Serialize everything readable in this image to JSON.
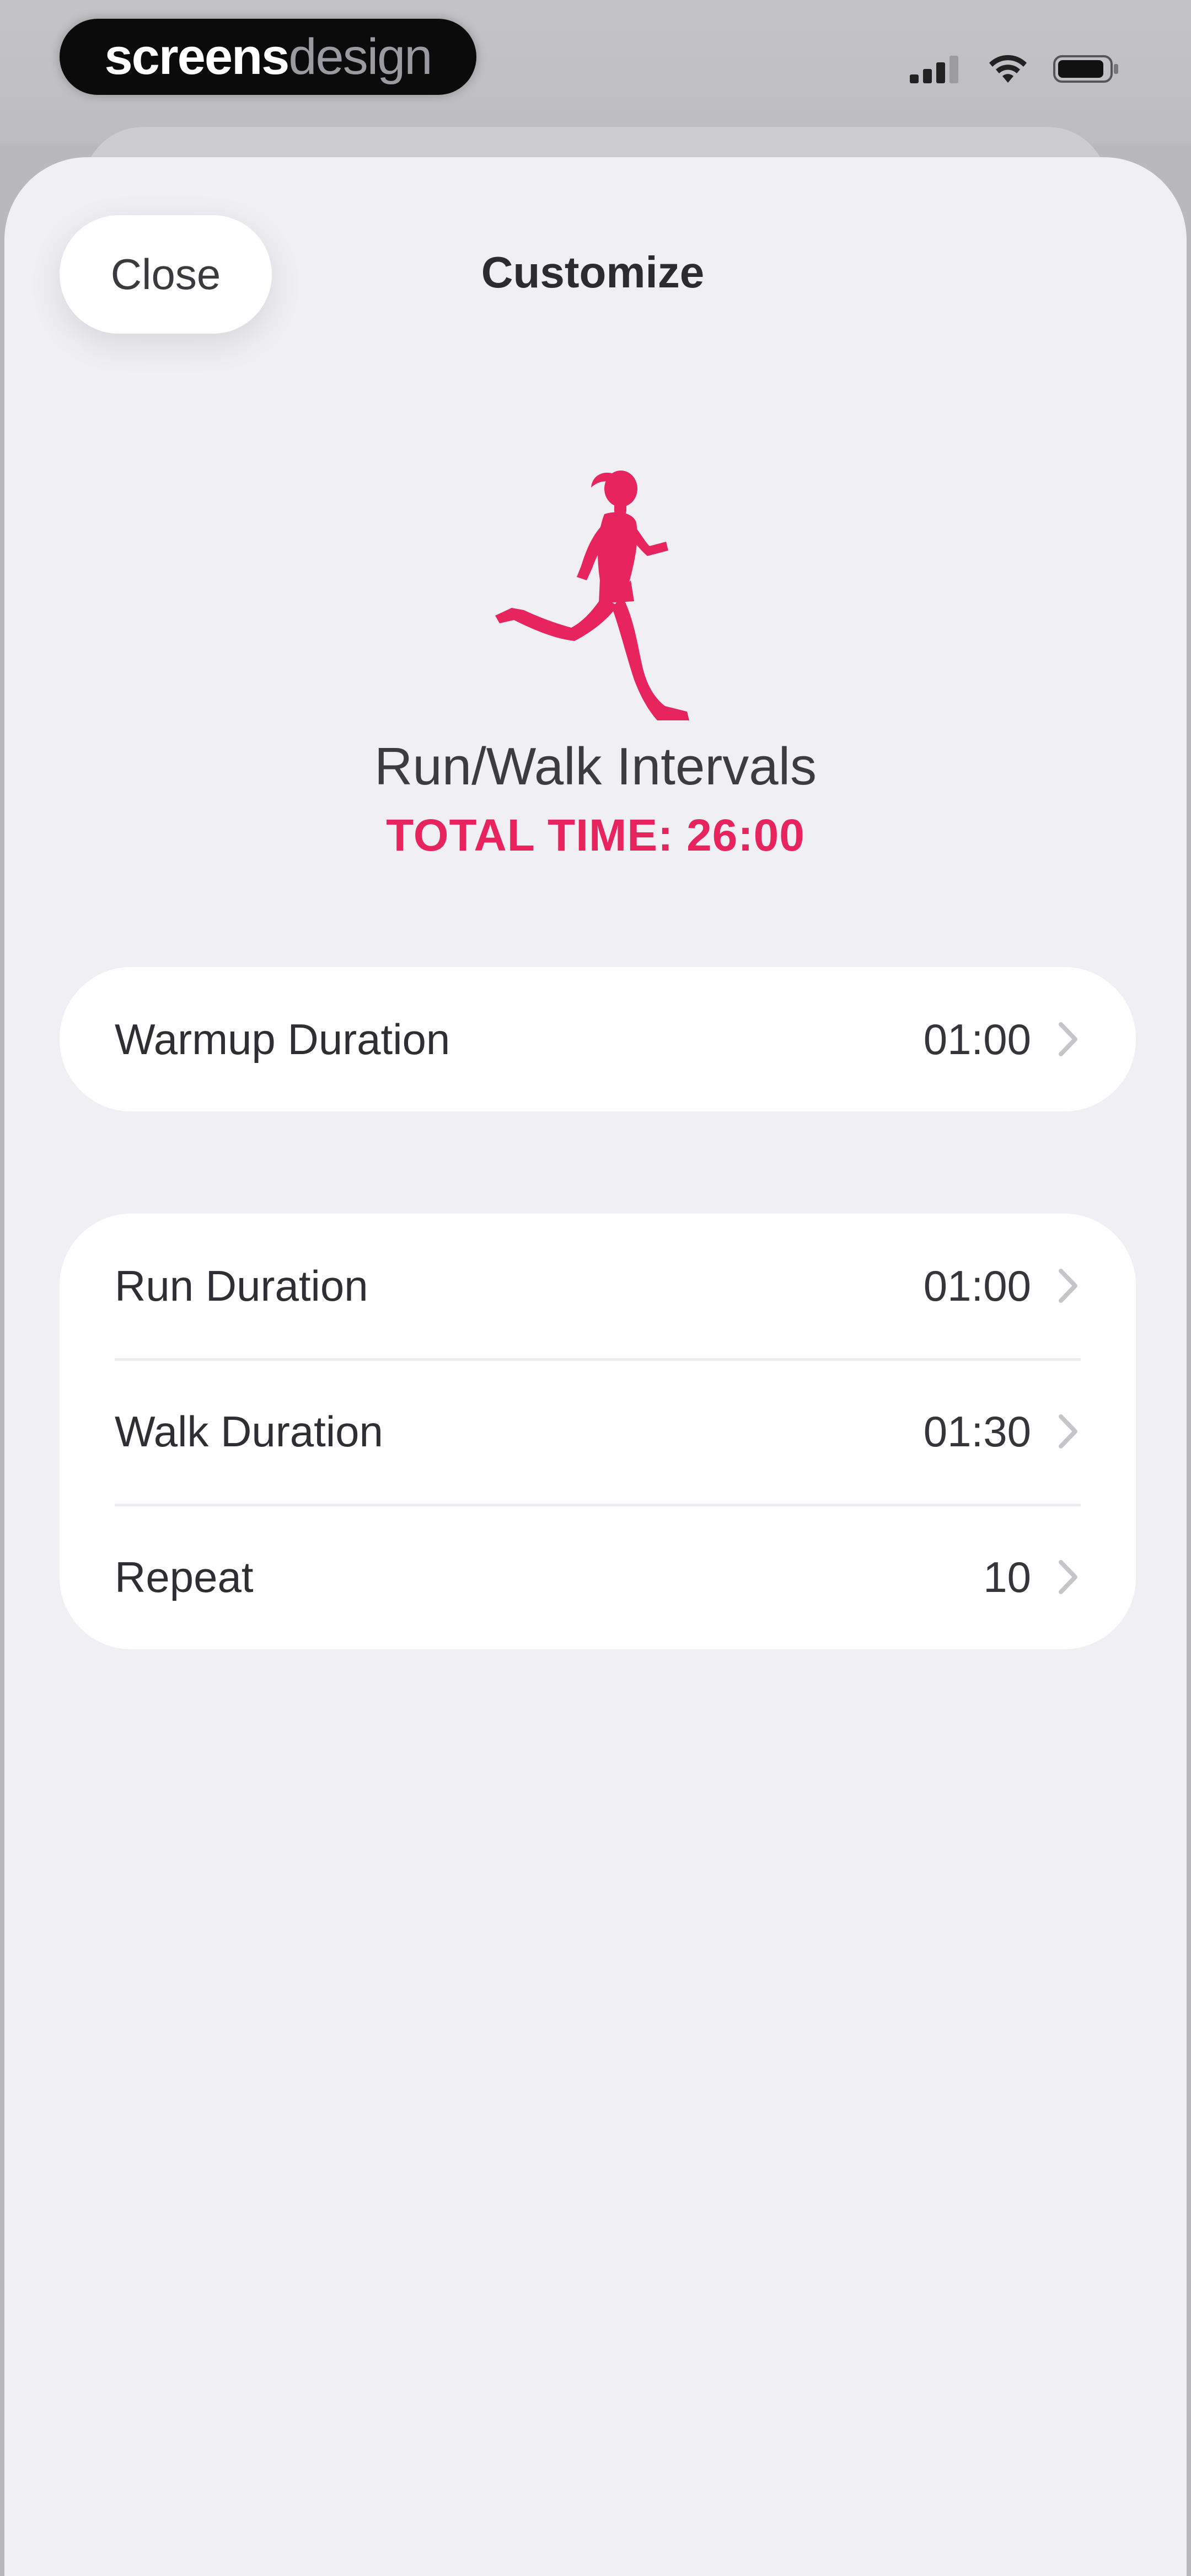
{
  "watermark": {
    "part1": "screens",
    "part2": "design"
  },
  "status_bar": {
    "icons": [
      "cellular-signal-icon",
      "wifi-icon",
      "battery-icon"
    ]
  },
  "nav": {
    "close_label": "Close",
    "title": "Customize"
  },
  "workout": {
    "icon": "running-woman-icon",
    "name": "Run/Walk Intervals",
    "total_time": "TOTAL TIME: 26:00"
  },
  "warmup": {
    "label": "Warmup Duration",
    "value": "01:00"
  },
  "intervals": [
    {
      "label": "Run Duration",
      "value": "01:00"
    },
    {
      "label": "Walk Duration",
      "value": "01:30"
    },
    {
      "label": "Repeat",
      "value": "10"
    }
  ],
  "colors": {
    "accent": "#e8245f",
    "background": "#efeff4",
    "card": "#ffffff",
    "text_primary": "#2e2e33"
  }
}
